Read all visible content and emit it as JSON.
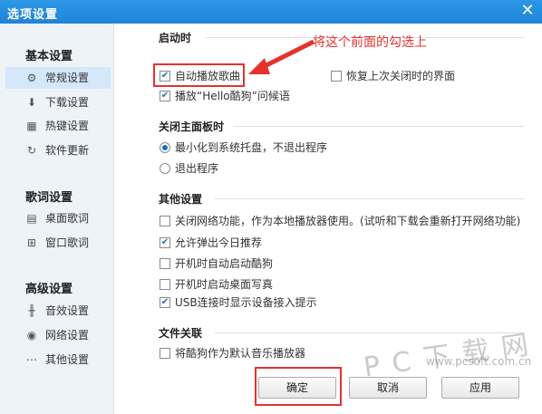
{
  "window": {
    "title": "选项设置",
    "close_glyph": "✕"
  },
  "sidebar": {
    "groups": [
      {
        "title": "基本设置",
        "items": [
          {
            "label": "常规设置",
            "icon": "gear-icon",
            "glyph": "⚙",
            "active": true
          },
          {
            "label": "下载设置",
            "icon": "download-icon",
            "glyph": "⬇"
          },
          {
            "label": "热键设置",
            "icon": "keyboard-icon",
            "glyph": "▦"
          },
          {
            "label": "软件更新",
            "icon": "update-icon",
            "glyph": "↻"
          }
        ]
      },
      {
        "title": "歌词设置",
        "items": [
          {
            "label": "桌面歌词",
            "icon": "desktop-lyrics-icon",
            "glyph": "▤"
          },
          {
            "label": "窗口歌词",
            "icon": "window-lyrics-icon",
            "glyph": "⊞"
          }
        ]
      },
      {
        "title": "高级设置",
        "items": [
          {
            "label": "音效设置",
            "icon": "equalizer-icon",
            "glyph": "╫"
          },
          {
            "label": "网络设置",
            "icon": "network-icon",
            "glyph": "◉"
          },
          {
            "label": "其他设置",
            "icon": "more-icon",
            "glyph": "⋯"
          }
        ]
      }
    ]
  },
  "sections": {
    "startup": {
      "title": "启动时",
      "auto_play": {
        "label": "自动播放歌曲",
        "checked": true
      },
      "restore_ui": {
        "label": "恢复上次关闭时的界面",
        "checked": false
      },
      "greeting": {
        "label": "播放“Hello酷狗”问候语",
        "checked": true
      }
    },
    "close_panel": {
      "title": "关闭主面板时",
      "minimize_tray": {
        "label": "最小化到系统托盘，不退出程序",
        "selected": true
      },
      "exit": {
        "label": "退出程序",
        "selected": false
      }
    },
    "other": {
      "title": "其他设置",
      "close_network": {
        "label": "关闭网络功能，作为本地播放器使用。(试听和下载会重新打开网络功能)",
        "checked": false
      },
      "daily_recommend": {
        "label": "允许弹出今日推荐",
        "checked": true
      },
      "auto_start": {
        "label": "开机时自动启动酷狗",
        "checked": false
      },
      "desktop_photo": {
        "label": "开机时启动桌面写真",
        "checked": false
      },
      "usb_prompt": {
        "label": "USB连接时显示设备接入提示",
        "checked": true
      }
    },
    "file_assoc": {
      "title": "文件关联",
      "default_player": {
        "label": "将酷狗作为默认音乐播放器",
        "checked": false
      }
    }
  },
  "buttons": {
    "ok": "确定",
    "cancel": "取消",
    "apply": "应用"
  },
  "annotation": {
    "text": "将这个前面的勾选上",
    "color": "#e5322d"
  },
  "watermark": {
    "brand": "P C 下 载 网",
    "url": "www.pcsoft.com.cn"
  },
  "colors": {
    "titlebar": "#1f84d6",
    "sidebar_bg": "#eef3f8",
    "active_item": "#d4e8fa",
    "highlight_red": "#e5322d"
  }
}
